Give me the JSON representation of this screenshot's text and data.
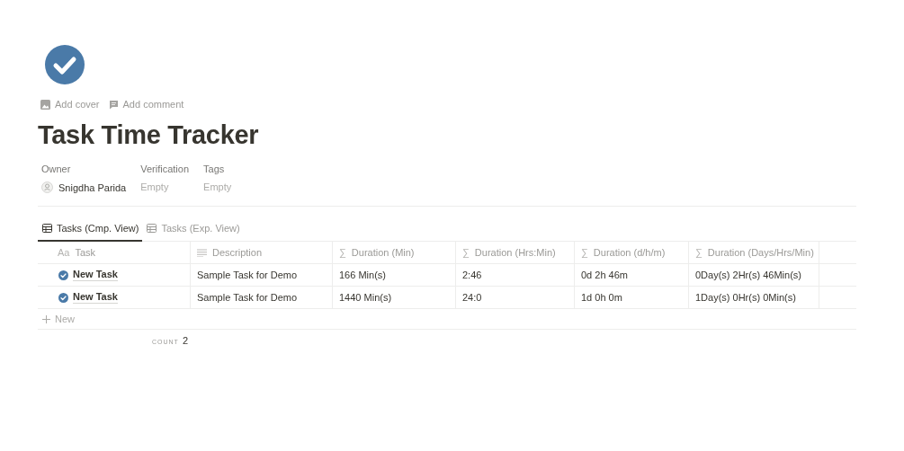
{
  "page_actions": [
    "Add cover",
    "Add comment"
  ],
  "title": "Task Time Tracker",
  "properties": [
    {
      "label": "Owner",
      "value": "Snigdha Parida",
      "empty": false,
      "kind": "person"
    },
    {
      "label": "Verification",
      "value": "Empty",
      "empty": true,
      "kind": "text"
    },
    {
      "label": "Tags",
      "value": "Empty",
      "empty": true,
      "kind": "text"
    }
  ],
  "tabs": [
    {
      "label": "Tasks (Cmp. View)",
      "selected": true
    },
    {
      "label": "Tasks (Exp. View)",
      "selected": false
    }
  ],
  "table": {
    "columns": [
      {
        "label": "Task",
        "kind": "title",
        "prefix": "Aa"
      },
      {
        "label": "Description",
        "kind": "text"
      },
      {
        "label": "Duration (Min)",
        "kind": "formula",
        "prefix": "∑"
      },
      {
        "label": "Duration (Hrs:Min)",
        "kind": "formula",
        "prefix": "∑"
      },
      {
        "label": "Duration (d/h/m)",
        "kind": "formula",
        "prefix": "∑"
      },
      {
        "label": "Duration (Days/Hrs/Min)",
        "kind": "formula",
        "prefix": "∑"
      }
    ],
    "rows": [
      [
        "New Task",
        "Sample Task for Demo",
        "166 Min(s)",
        "2:46",
        "0d 2h 46m",
        "0Day(s) 2Hr(s) 46Min(s)"
      ],
      [
        "New Task",
        "Sample Task for Demo",
        "1440 Min(s)",
        "24:0",
        "1d 0h 0m",
        "1Day(s) 0Hr(s) 0Min(s)"
      ]
    ],
    "new_row": "New",
    "footer": {
      "label": "COUNT",
      "value": "2"
    }
  }
}
